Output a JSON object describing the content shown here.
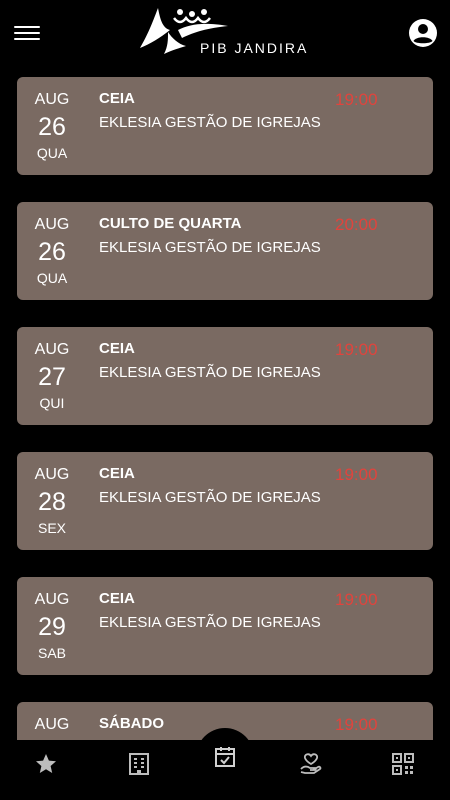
{
  "header": {
    "brand": "PIB JANDIRA",
    "icons": {
      "menu": "hamburger-menu-icon",
      "profile": "account-circle-icon"
    }
  },
  "events": [
    {
      "month": "AUG",
      "day": "26",
      "weekday": "QUA",
      "title": "CEIA",
      "subtitle": "EKLESIA GESTÃO DE IGREJAS",
      "time": "19:00"
    },
    {
      "month": "AUG",
      "day": "26",
      "weekday": "QUA",
      "title": "CULTO DE QUARTA",
      "subtitle": "EKLESIA GESTÃO DE IGREJAS",
      "time": "20:00"
    },
    {
      "month": "AUG",
      "day": "27",
      "weekday": "QUI",
      "title": "CEIA",
      "subtitle": "EKLESIA GESTÃO DE IGREJAS",
      "time": "19:00"
    },
    {
      "month": "AUG",
      "day": "28",
      "weekday": "SEX",
      "title": "CEIA",
      "subtitle": "EKLESIA GESTÃO DE IGREJAS",
      "time": "19:00"
    },
    {
      "month": "AUG",
      "day": "29",
      "weekday": "SAB",
      "title": "CEIA",
      "subtitle": "EKLESIA GESTÃO DE IGREJAS",
      "time": "19:00"
    },
    {
      "month": "AUG",
      "day": "",
      "weekday": "",
      "title": "SÁBADO",
      "subtitle": "",
      "time": "19:00"
    }
  ],
  "colors": {
    "card": "#7a6a62",
    "time": "#e0443d",
    "background": "#000000"
  },
  "bottom_nav": [
    {
      "icon": "star-icon"
    },
    {
      "icon": "building-icon"
    },
    {
      "icon": "calendar-check-icon"
    },
    {
      "icon": "hand-heart-icon"
    },
    {
      "icon": "qr-code-icon"
    }
  ]
}
